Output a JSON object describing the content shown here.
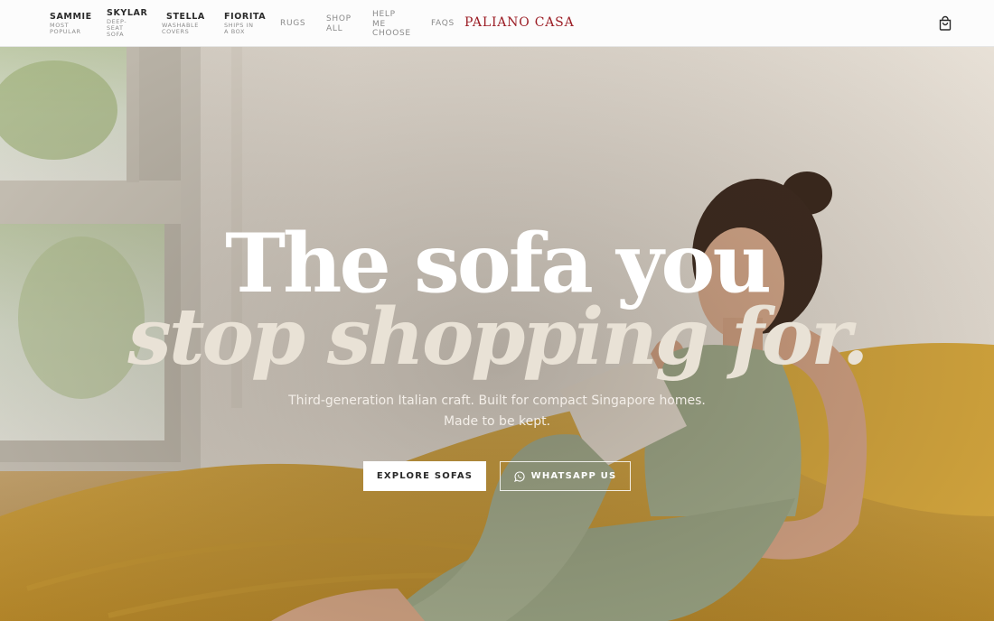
{
  "nav": {
    "items": [
      {
        "name": "SAMMIE",
        "sub": "MOST\nPOPULAR"
      },
      {
        "name": "SKYLAR",
        "sub": "DEEP-\nSEAT\nSOFA"
      },
      {
        "name": "STELLA",
        "sub": "WASHABLE\nCOVERS"
      },
      {
        "name": "FIORITA",
        "sub": "SHIPS IN\nA BOX"
      }
    ],
    "links": [
      "RUGS",
      "SHOP\nALL",
      "HELP\nME\nCHOOSE",
      "FAQS"
    ],
    "brand": "PALIANO CASA",
    "cart_icon": "shopping-bag-icon"
  },
  "hero": {
    "headline_1": "The sofa you",
    "headline_2": "stop shopping for.",
    "subtitle_1": "Third-generation Italian craft. Built for compact Singapore homes.",
    "subtitle_2": "Made to be kept.",
    "primary_cta": "EXPLORE SOFAS",
    "secondary_cta": "WHATSAPP US",
    "secondary_icon": "whatsapp-icon"
  },
  "colors": {
    "brand": "#9b1c24",
    "sofa": "#d9a93a",
    "outfit": "#a2ad8d"
  }
}
